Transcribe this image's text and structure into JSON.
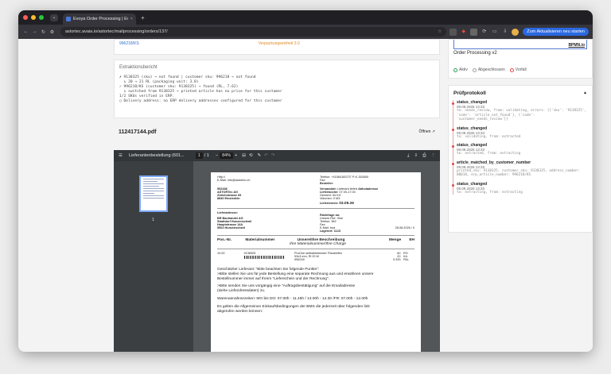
{
  "browser": {
    "tab_title": "Evoya Order Processing | Evo",
    "url": "astortec.avaia.io/astortec/mailprocessing/orders/137/",
    "update_label": "Zum Aktualisieren neu starten",
    "colors": {
      "close": "#ff5f57",
      "minimize": "#febc2e",
      "maximize": "#28c840",
      "accent": "#2b68e0"
    }
  },
  "top_strip": {
    "left": "996218/KS",
    "right": "Verpackungseinheit 3.0"
  },
  "extraction": {
    "heading": "Extraktionsbericht",
    "lines": [
      "✗ 9138325 (sku) → not found | customer sku: 996218 → not found",
      "  ↳ 20 → 21 RL (packaging unit: 3.0)",
      "✓ 996218/KS (customer sku: 9138325) → found (RL, 7.62)",
      "  ↳ switched from 9138325 → printed article has no price for this customer",
      "",
      "1/2 SKUs verified in ERP.",
      "○ Delivery address: no ERP delivery addresses configured for this customer"
    ]
  },
  "pdf": {
    "filename": "112417144.pdf",
    "open_label": "Öffnen ↗",
    "viewer": {
      "title": "Lieferantenbestellung (601...",
      "page_current": "1",
      "page_total": "/ 1",
      "zoom": "84%",
      "thumb_number": "1"
    },
    "doc": {
      "http": "Http://",
      "email_label": "E-Mail:",
      "email": "info@astortec.ch",
      "telefon": "Telefon:",
      "telefon_val": "+41564183727",
      "pk": "P-K-302600",
      "fax": "Fax:",
      "besteller": "Besteller:",
      "addr_code": "952338",
      "addr_company": "ASTORTec AG",
      "addr_street": "Zürichstrasse 69",
      "addr_city": "8840   Einsiedeln",
      "versandart": "Versandart:",
      "versandart_val": "Lieferant liefert",
      "abholadresse": "Abholadresse",
      "lieferwoche": "Lieferwoche:",
      "lieferwoche_val": "07.00-17.00",
      "gewicht": "Gewicht:",
      "gewicht_val": "54   KG",
      "volumen": "Volumen:",
      "volumen_val": "0   M3",
      "liefertermin": "Liefertermin:",
      "liefertermin_val": "03.09.26",
      "lieferadresse": "Lieferadresse:",
      "del_company": "BR Bauhandel AG",
      "del_contact": "Stadtdorf Hunzenschwil",
      "del_street": "Hauptstrasse 14A",
      "del_city": "5502   Hunzenschwil",
      "rueckfrage": "Rückfrage an:",
      "unsere_ref": "Unsere Ref.:   Bne",
      "telefon2": "Telefon:   962",
      "fax2": "Fax:",
      "email2": "E-Mail:   bod",
      "lagerort": "Lagerort:   1123",
      "date_line": "28.08.2026  /  0",
      "col_pos": "Pos.-Nr.",
      "col_mat": "Materialnummer",
      "col_desc": "Unsere/Ihre Beschreibung",
      "col_desc2": "Ihre Materialnummer/Ihre Charge",
      "col_qty": "Menge",
      "col_unit": "EH",
      "row_pos": "10.00",
      "row_mat": "9138325",
      "row_desc1": "ProOne selbstklebender Filzstreifen",
      "row_desc2": "93x3 mm, Rl 20 M",
      "row_desc3": "996218",
      "row_qty1": "60",
      "row_unit1": "RO",
      "row_qty2": "20",
      "row_unit2": "KA",
      "row_qty3": "0.333",
      "row_unit3": "PAL",
      "note1": "Geschätzter Lieferant: \"Bitte beachten Sie folgende Punkte\":",
      "note2": ">Bitte stellen Sie uns für jede Bestellung eine separate Rechnung aus und erwähnen unsere",
      "note3": "Bestellnummer immer auf Ihrem \"Lieferschein und der Rechnung\".",
      "note4": ">Bitte senden Sie uns vorgängig eine \"Auftragsbestätigung\" auf die Emailadresse",
      "note5": "(siehe Liefezdressdaten) zu.",
      "note6": "Warenannahmezeiten: MO bis DO: 07.00h - 11.45h / 13.00h - 14.30 /FR: 07.00h - 12.00h",
      "note7": "Es gelten die Allgemeinen Einkaufsbedingungen der BMS die jederzeit über folgenden link",
      "note8": "abgerufen werden können:"
    }
  },
  "sidebar": {
    "bpmn_label": "BPMN.io",
    "process_title": "Order Processing v2",
    "legend": [
      {
        "label": "Aktiv",
        "color": "#2f9e57"
      },
      {
        "label": "Abgeschlossen",
        "color": "#9aa0a6"
      },
      {
        "label": "Vorfall",
        "color": "#e04747"
      }
    ],
    "protocol_title": "Prüfprotokoll",
    "collapse_icon": "▲",
    "entries": [
      {
        "event": "status_changed",
        "time": "09.09.2026 13:33",
        "detail": "to: needs_review, from: validating, errors: [{'sku': '9138325', 'code': 'article_not_found'}, {'code': 'customer_needs_review'}]"
      },
      {
        "event": "status_changed",
        "time": "09.09.2026 13:33",
        "detail": "to: validating, from: extracted"
      },
      {
        "event": "status_changed",
        "time": "09.09.2026 13:33",
        "detail": "to: extracted, from: extracting"
      },
      {
        "event": "article_matched_by_customer_number",
        "time": "09.09.2026 13:33",
        "detail": "printed_sku: 9138325, customer_sku: 9138325, address_number: 00018, erp_article_number: 996218/KS"
      },
      {
        "event": "status_changed",
        "time": "09.09.2026 13:33",
        "detail": "to: extracting, from: extracting"
      }
    ]
  }
}
